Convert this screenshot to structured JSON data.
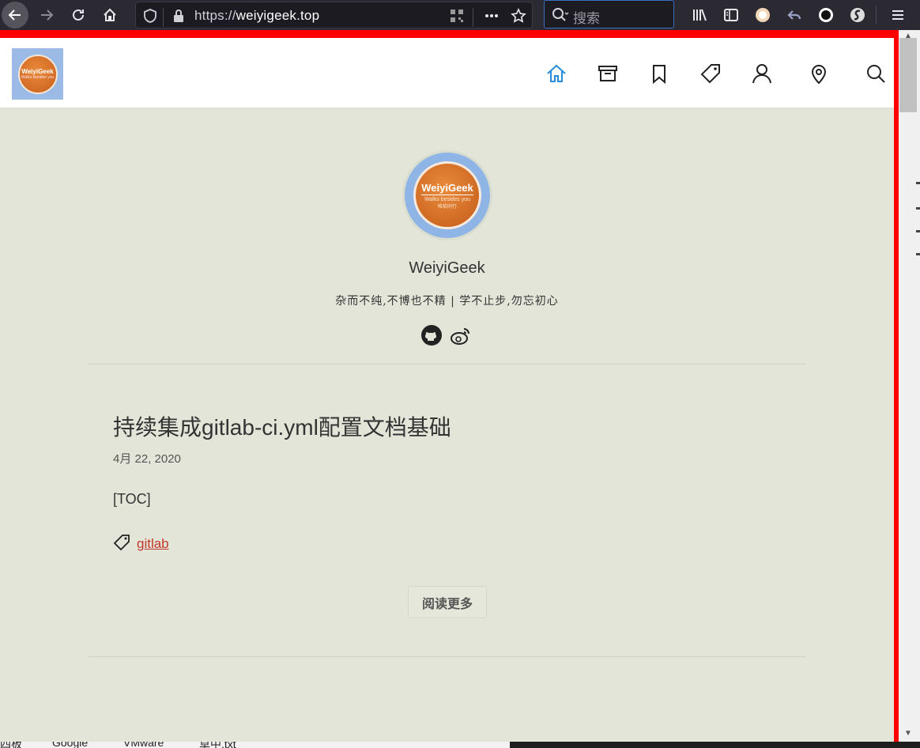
{
  "browser": {
    "url_scheme": "https://",
    "url_host": "weiyigeek.top",
    "search_placeholder": "搜索"
  },
  "site": {
    "logo_title": "WeiyiGeek",
    "logo_tagline": "Walks besides you",
    "logo_subtag": "唯依同行",
    "name": "WeiyiGeek",
    "motto": "杂而不纯,不博也不精 | 学不止步,勿忘初心"
  },
  "nav": {
    "items": [
      "home-icon",
      "archive-icon",
      "bookmark-icon",
      "tag-icon",
      "user-icon",
      "location-icon",
      "search-icon"
    ],
    "accent": "#2a8cd6"
  },
  "post": {
    "title": "持续集成gitlab-ci.yml配置文档基础",
    "date": "4月 22, 2020",
    "excerpt": "[TOC]",
    "tag": "gitlab",
    "read_more": "阅读更多"
  },
  "taskbar": {
    "items": [
      "四板",
      "Google",
      "VMware",
      "草中.txt"
    ]
  },
  "colors": {
    "page_bg": "#e2e5d8",
    "toolbar_bg": "#2b2a33",
    "frame_red": "#ff0000",
    "tag_link": "#c0392b"
  }
}
